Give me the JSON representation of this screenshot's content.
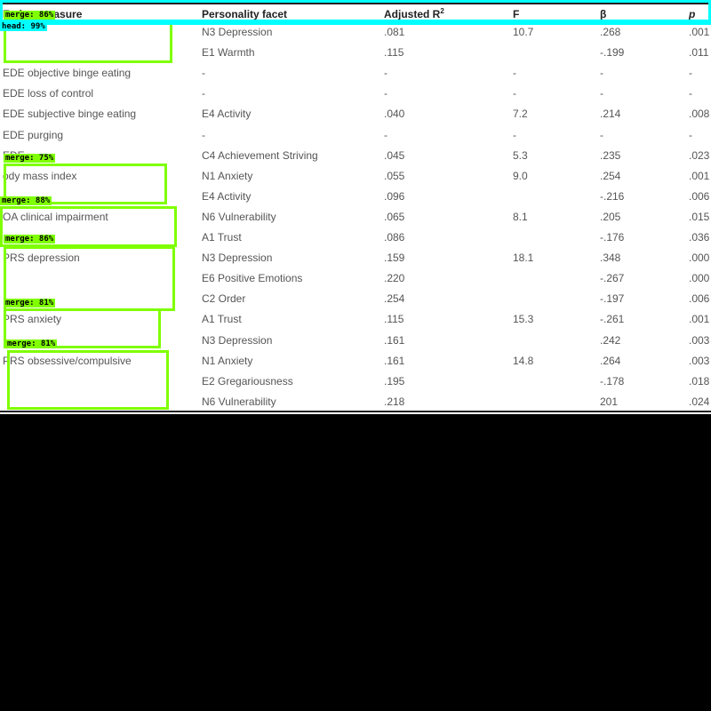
{
  "table": {
    "headers": [
      "Eating measure",
      "Personality facet",
      "Adjusted R",
      "F",
      "β",
      "p"
    ],
    "r2_superscript": "2",
    "rows": [
      [
        "",
        "N3 Depression",
        ".081",
        "10.7",
        ".268",
        ".001"
      ],
      [
        "",
        "E1 Warmth",
        ".115",
        "",
        "-.199",
        ".011"
      ],
      [
        "EDE objective binge eating",
        "-",
        "-",
        "-",
        "-",
        "-"
      ],
      [
        "EDE loss of control",
        "-",
        "-",
        "-",
        "-",
        "-"
      ],
      [
        "EDE subjective binge eating",
        "E4 Activity",
        ".040",
        "7.2",
        ".214",
        ".008"
      ],
      [
        "EDE purging",
        "-",
        "-",
        "-",
        "-",
        "-"
      ],
      [
        "EDE",
        "C4 Achievement Striving",
        ".045",
        "5.3",
        ".235",
        ".023"
      ],
      [
        "ody mass index",
        "N1 Anxiety",
        ".055",
        "9.0",
        ".254",
        ".001"
      ],
      [
        "",
        "E4 Activity",
        ".096",
        "",
        "-.216",
        ".006"
      ],
      [
        "OA clinical impairment",
        "N6 Vulnerability",
        ".065",
        "8.1",
        ".205",
        ".015"
      ],
      [
        "",
        "A1 Trust",
        ".086",
        "",
        "-.176",
        ".036"
      ],
      [
        "PRS depression",
        "N3 Depression",
        ".159",
        "18.1",
        ".348",
        ".000"
      ],
      [
        "",
        "E6 Positive Emotions",
        ".220",
        "",
        "-.267",
        ".000"
      ],
      [
        "",
        "C2 Order",
        ".254",
        "",
        "-.197",
        ".006"
      ],
      [
        "PRS anxiety",
        "A1 Trust",
        ".115",
        "15.3",
        "-.261",
        ".001"
      ],
      [
        "",
        "N3 Depression",
        ".161",
        "",
        ".242",
        ".003"
      ],
      [
        "PRS obsessive/compulsive",
        "N1 Anxiety",
        ".161",
        "14.8",
        ".264",
        ".003"
      ],
      [
        "",
        "E2 Gregariousness",
        ".195",
        "",
        "-.178",
        ".018"
      ],
      [
        "",
        "N6 Vulnerability",
        ".218",
        "",
        "201",
        ".024"
      ]
    ]
  },
  "overlays": [
    {
      "label": "merge: 86%",
      "color": "#7fff00"
    },
    {
      "label": "head: 99%",
      "color": "#00ffff"
    },
    {
      "label": "merge: 75%",
      "color": "#7fff00"
    },
    {
      "label": "merge: 88%",
      "color": "#7fff00"
    },
    {
      "label": "merge: 86%",
      "color": "#7fff00"
    },
    {
      "label": "merge: 81%",
      "color": "#7fff00"
    },
    {
      "label": "merge: 81%",
      "color": "#7fff00"
    }
  ]
}
